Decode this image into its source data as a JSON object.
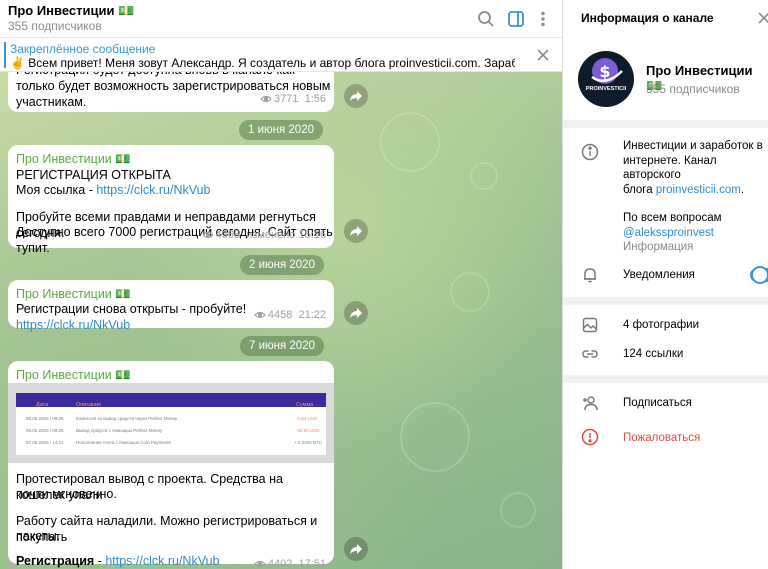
{
  "chat": {
    "title": "Про Инвестиции 💵",
    "subscribers": "355 подписчиков",
    "pinned": {
      "label": "Закреплённое сообщение",
      "text": "✌️ Всем привет!  Меня зовут Александр. Я создатель и автор блога proinvesticii.com. Зарабатываю в инт..."
    },
    "messages": [
      {
        "text_lines": [
          "Регистрация будет доступна вновь в канале как",
          "только будет возможность зарегистрироваться новым",
          "участникам."
        ],
        "views": "3771",
        "time": "1:56"
      },
      {
        "date": "1 июня 2020",
        "author": "Про Инвестиции 💵",
        "line1": "РЕГИСТРАЦИЯ ОТКРЫТА",
        "line2_prefix": "Моя ссылка - ",
        "link": "https://clck.ru/NkVub",
        "line3": "Пробуйте всеми правдами и неправдами регнуться сегодня.",
        "line4": "Доступно всего 7000 регистраций сегодня. Сайт опять тупит.",
        "views": "4365",
        "time": "изменено 15:16"
      },
      {
        "date": "2 июня 2020",
        "author": "Про Инвестиции 💵",
        "text_prefix": "Регистрации снова открыты - пробуйте! ",
        "link": "https://clck.ru/NkVub",
        "views": "4458",
        "time": "21:22"
      },
      {
        "date": "7 июня 2020",
        "author": "Про Инвестиции 💵",
        "image": {
          "headers": [
            "Дата",
            "Описание",
            "Сумма"
          ],
          "rows": [
            [
              "05.06.2020 / 09:25",
              "Комиссия за вывод средств через Perfect Money",
              "-1.84 USD"
            ],
            [
              "06.06.2020 / 09:25",
              "Вывод средств с помощью Perfect Money",
              "-92.00 USD"
            ],
            [
              "07.06.2020 / 14:21",
              "Пополнение счета с помощью Coin Payments",
              "+ 0.2000 BTC"
            ]
          ]
        },
        "line1": "Протестировал вывод с проекта. Средства на кошелек упали",
        "line2": "почти мгновенно.",
        "line3": "Работу сайта наладили. Можно регистрироваться и покупать",
        "line4": "пакеты.",
        "bold_label": "Регистрация",
        "dash": " - ",
        "link": "https://clck.ru/NkVub",
        "views": "4402",
        "time": "17:51"
      }
    ]
  },
  "info": {
    "header": "Информация о канале",
    "avatar_caption": "PROINVESTICII",
    "name": "Про Инвестиции 💵",
    "subscribers": "355 подписчиков",
    "description_lines": [
      "Инвестиции и заработок в",
      "интернете. Канал авторского"
    ],
    "description_prefix": "блога ",
    "description_link": "proinvesticii.com",
    "description_suffix": ".",
    "contact_text": "По всем вопросам",
    "contact_link": "@alekssproinvest",
    "info_label": "Информация",
    "notifications": "Уведомления",
    "notifications_on": true,
    "photos": "4 фотографии",
    "links": "124 ссылки",
    "subscribe": "Подписаться",
    "report": "Пожаловаться"
  },
  "colors": {
    "accent": "#3a95d5",
    "author": "#5ba944",
    "danger": "#e64b3c"
  }
}
